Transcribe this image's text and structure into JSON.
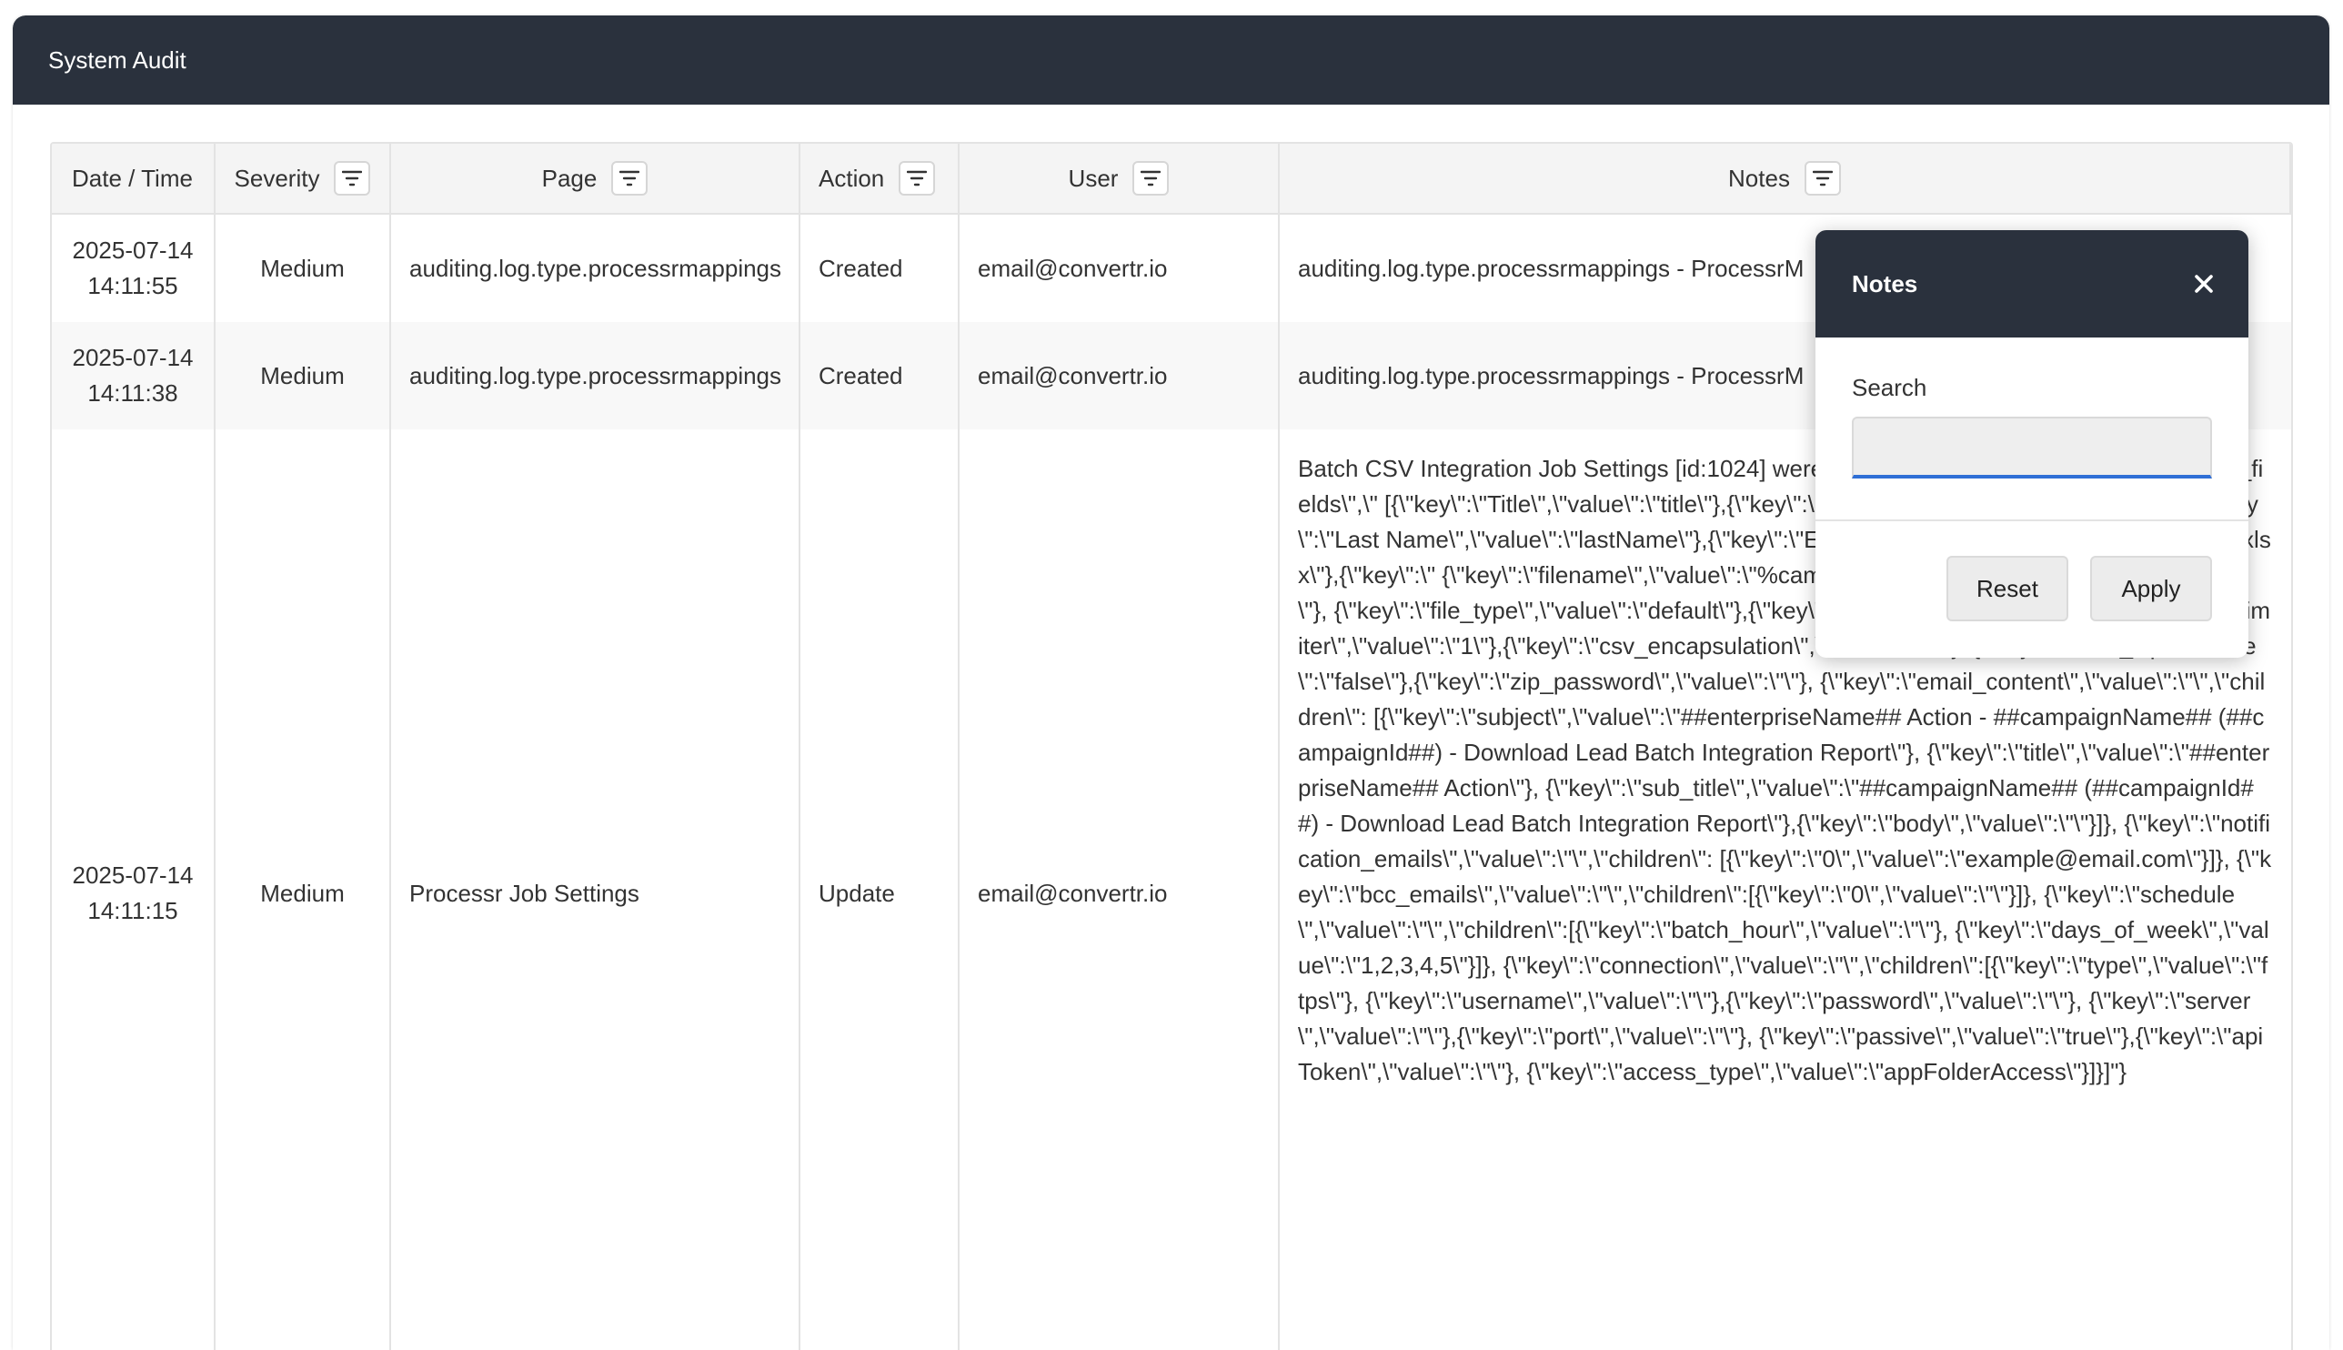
{
  "header": {
    "title": "System Audit"
  },
  "columns": {
    "date": "Date / Time",
    "severity": "Severity",
    "page": "Page",
    "action": "Action",
    "user": "User",
    "notes": "Notes"
  },
  "rows": [
    {
      "date": "2025-07-14",
      "time": "14:11:55",
      "severity": "Medium",
      "page": "auditing.log.type.processrmappings",
      "action": "Created",
      "user": "email@convertr.io",
      "notes": "auditing.log.type.processrmappings - ProcessrM"
    },
    {
      "date": "2025-07-14",
      "time": "14:11:38",
      "severity": "Medium",
      "page": "auditing.log.type.processrmappings",
      "action": "Created",
      "user": "email@convertr.io",
      "notes": "auditing.log.type.processrmappings - ProcessrM"
    },
    {
      "date": "2025-07-14",
      "time": "14:11:15",
      "severity": "Medium",
      "page": "Processr Job Settings",
      "action": "Update",
      "user": "email@convertr.io",
      "notes": "Batch CSV Integration Job Settings [id:1024] were {\"enterpriseSettings\":\"[{\\\"key\\\":\\\"include_fields\\\",\\\" [{\\\"key\\\":\\\"Title\\\",\\\"value\\\":\\\"title\\\"},{\\\"key\\\":\\\"First Name\\\",\\\"value\\\":\\\"firstName\\\"},{\\\"key\\\":\\\"Last Name\\\",\\\"value\\\":\\\"lastName\\\"},{\\\"key\\\":\\\"Email\\\",\\\" {\\\"key\\\":\\\"file_format\\\",\\\"value\\\":\\\"xlsx\\\"},{\\\"key\\\":\\\" {\\\"key\\\":\\\"filename\\\",\\\"value\\\":\\\"%campID%-%Y%-%m%-%d%-%H%-%i%.xlsx\\\"}, {\\\"key\\\":\\\"file_type\\\",\\\"value\\\":\\\"default\\\"},{\\\"key\\\":\\\"path\\\",\\\"value\\\":\\\"\\/\\\"}, {\\\"key\\\":\\\"csv_delimiter\\\",\\\"value\\\":\\\"1\\\"},{\\\"key\\\":\\\"csv_encapsulation\\\",\\\"value\\\":\\\"0\\\"}, {\\\"key\\\":\\\"send_zip\\\",\\\"value\\\":\\\"false\\\"},{\\\"key\\\":\\\"zip_password\\\",\\\"value\\\":\\\"\\\"}, {\\\"key\\\":\\\"email_content\\\",\\\"value\\\":\\\"\\\",\\\"children\\\": [{\\\"key\\\":\\\"subject\\\",\\\"value\\\":\\\"##enterpriseName## Action - ##campaignName## (##campaignId##) - Download Lead Batch Integration Report\\\"}, {\\\"key\\\":\\\"title\\\",\\\"value\\\":\\\"##enterpriseName## Action\\\"}, {\\\"key\\\":\\\"sub_title\\\",\\\"value\\\":\\\"##campaignName## (##campaignId##) - Download Lead Batch Integration Report\\\"},{\\\"key\\\":\\\"body\\\",\\\"value\\\":\\\"\\\"}]}, {\\\"key\\\":\\\"notification_emails\\\",\\\"value\\\":\\\"\\\",\\\"children\\\": [{\\\"key\\\":\\\"0\\\",\\\"value\\\":\\\"example@email.com\\\"}]}, {\\\"key\\\":\\\"bcc_emails\\\",\\\"value\\\":\\\"\\\",\\\"children\\\":[{\\\"key\\\":\\\"0\\\",\\\"value\\\":\\\"\\\"}]}, {\\\"key\\\":\\\"schedule\\\",\\\"value\\\":\\\"\\\",\\\"children\\\":[{\\\"key\\\":\\\"batch_hour\\\",\\\"value\\\":\\\"\\\"}, {\\\"key\\\":\\\"days_of_week\\\",\\\"value\\\":\\\"1,2,3,4,5\\\"}]}, {\\\"key\\\":\\\"connection\\\",\\\"value\\\":\\\"\\\",\\\"children\\\":[{\\\"key\\\":\\\"type\\\",\\\"value\\\":\\\"ftps\\\"}, {\\\"key\\\":\\\"username\\\",\\\"value\\\":\\\"\\\"},{\\\"key\\\":\\\"password\\\",\\\"value\\\":\\\"\\\"}, {\\\"key\\\":\\\"server\\\",\\\"value\\\":\\\"\\\"},{\\\"key\\\":\\\"port\\\",\\\"value\\\":\\\"\\\"}, {\\\"key\\\":\\\"passive\\\",\\\"value\\\":\\\"true\\\"},{\\\"key\\\":\\\"apiToken\\\",\\\"value\\\":\\\"\\\"}, {\\\"key\\\":\\\"access_type\\\",\\\"value\\\":\\\"appFolderAccess\\\"}]}]\"}"
    }
  ],
  "filter_popup": {
    "title": "Notes",
    "search_label": "Search",
    "search_value": "",
    "reset_label": "Reset",
    "apply_label": "Apply"
  },
  "colors": {
    "header_bg": "#2a313d",
    "accent": "#2f6fd6"
  },
  "icons": {
    "filter": "filter-icon",
    "close": "close-icon"
  }
}
